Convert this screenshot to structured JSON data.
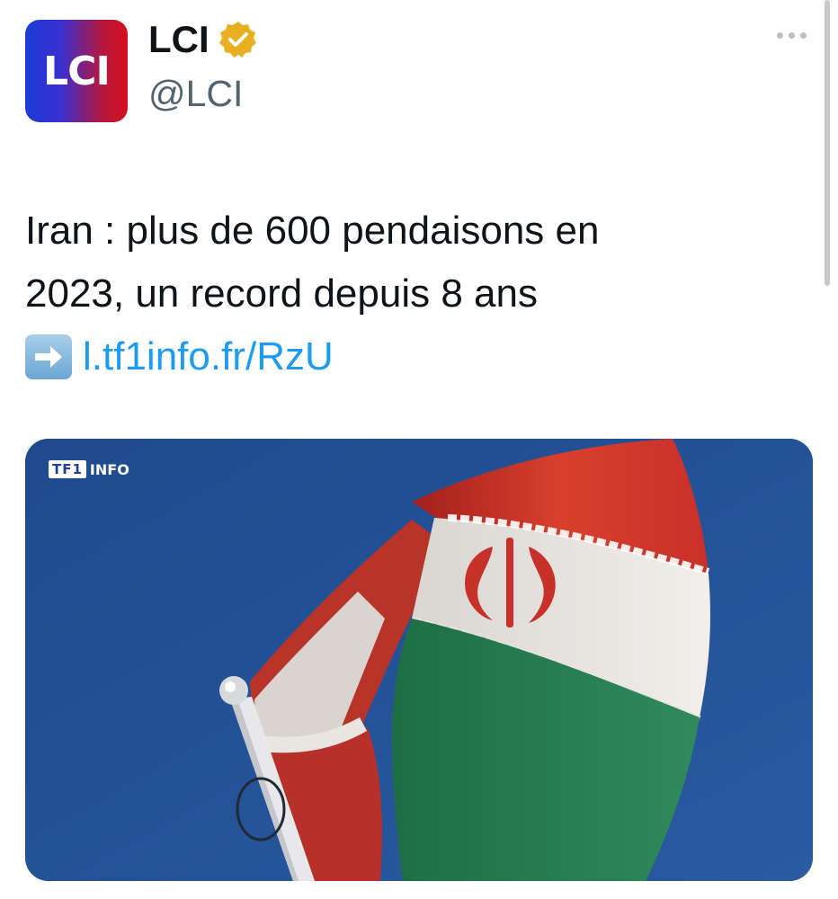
{
  "account": {
    "avatar_text": "LCI",
    "display_name": "LCI",
    "handle": "@LCI"
  },
  "tweet": {
    "line1": "Iran : plus de 600 pendaisons en",
    "line2": "2023, un record depuis 8 ans",
    "link_text": "l.tf1info.fr/RzU"
  },
  "media": {
    "brand_box": "TF1",
    "brand_text": "INFO"
  },
  "icons": {
    "verified": "verified-badge-icon",
    "arrow": "right-arrow-emoji-icon",
    "more": "more-options-icon"
  },
  "colors": {
    "link": "#1d9bf0",
    "handle": "#536471",
    "badge": "#e8b020",
    "sky": "#214a8c",
    "flag_red": "#d8402c",
    "flag_green": "#2f8a5c"
  }
}
